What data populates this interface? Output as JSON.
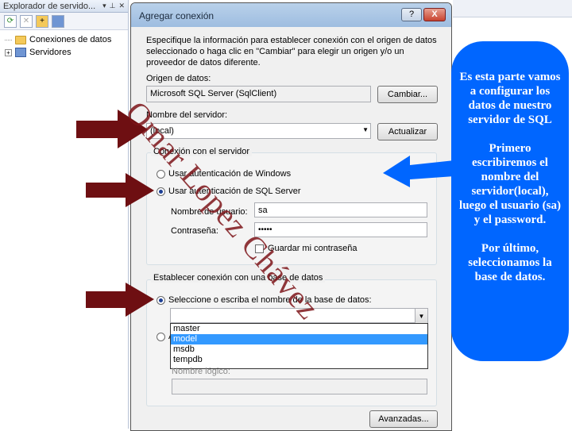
{
  "explorer": {
    "title": "Explorador de servido...",
    "title_controls": [
      "▾",
      "⊥",
      "✕"
    ],
    "tools": [
      "refresh-icon",
      "stop-icon",
      "connect-icon",
      "server-icon"
    ],
    "tree": [
      {
        "label": "Conexiones de datos",
        "icon": "folder-icon",
        "expander": ""
      },
      {
        "label": "Servidores",
        "icon": "server-icon",
        "expander": "+"
      }
    ]
  },
  "dialog": {
    "title": "Agregar conexión",
    "help_label": "?",
    "close_label": "X",
    "description": "Especifique la información para establecer conexión con el origen de datos seleccionado o haga clic en \"Cambiar\" para elegir un origen y/o un proveedor de datos diferente.",
    "datasource_label": "Origen de datos:",
    "datasource_value": "Microsoft SQL Server (SqlClient)",
    "change_button": "Cambiar...",
    "server_label": "Nombre del servidor:",
    "server_value": "(local)",
    "refresh_button": "Actualizar",
    "server_group": {
      "title": "Conexión con el servidor",
      "windows_auth": "Usar autenticación de Windows",
      "sql_auth": "Usar autenticación de SQL Server",
      "auth_selected": "sql",
      "username_label": "Nombre de usuario:",
      "username_value": "sa",
      "password_label": "Contraseña:",
      "password_value": "•••••",
      "save_password": "Guardar mi contraseña",
      "save_password_checked": false
    },
    "db_group": {
      "title": "Establecer conexión con una base de datos",
      "select_db_label": "Seleccione o escriba el nombre de la base de datos:",
      "db_value": "",
      "db_options": [
        "master",
        "model",
        "msdb",
        "tempdb"
      ],
      "db_highlighted": "model",
      "attach_label_fragment": "A",
      "logical_name_label": "Nombre lógico:",
      "logical_name_value": ""
    },
    "advanced_button": "Avanzadas..."
  },
  "callout": {
    "paragraph1": "Es esta parte vamos a configurar los datos de nuestro servidor de SQL",
    "paragraph2": "Primero escribiremos el nombre del servidor(local), luego el usuario (sa) y el password.",
    "paragraph3": "Por último, seleccionamos la base de datos."
  },
  "watermark": "Omar Lopez Chávez",
  "colors": {
    "arrow": "#6e0f12",
    "callout": "#0066ff",
    "watermark": "#7d1419"
  }
}
